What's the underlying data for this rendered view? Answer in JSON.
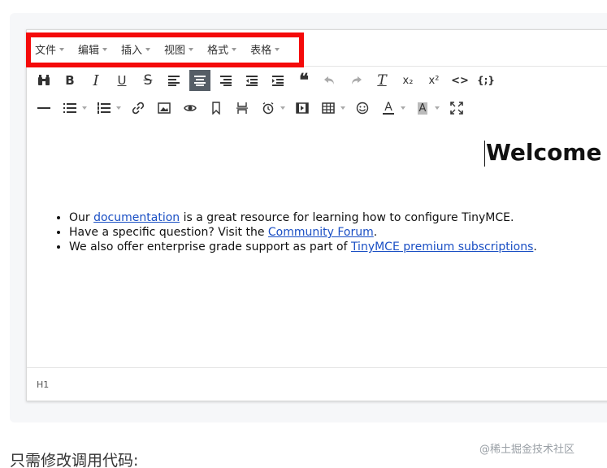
{
  "menubar": {
    "items": [
      {
        "label": "文件"
      },
      {
        "label": "编辑"
      },
      {
        "label": "插入"
      },
      {
        "label": "视图"
      },
      {
        "label": "格式"
      },
      {
        "label": "表格"
      }
    ]
  },
  "toolbar": {
    "bold": "B",
    "italic": "I",
    "underline": "U",
    "strike": "S",
    "clear_format": "T",
    "subscript": "x₂",
    "superscript": "x²",
    "code": "<>",
    "code_sample": "{;}",
    "text_color": "A",
    "bg_color": "A",
    "active_button": "align-center-button"
  },
  "content": {
    "heading": "Welcome",
    "list": [
      {
        "before": "Our ",
        "link": "documentation",
        "after": " is a great resource for learning how to configure TinyMCE."
      },
      {
        "before": "Have a specific question? Visit the ",
        "link": "Community Forum",
        "after": "."
      },
      {
        "before": "We also offer enterprise grade support as part of ",
        "link": "TinyMCE premium subscriptions",
        "after": "."
      }
    ]
  },
  "statusbar": {
    "path": "H1"
  },
  "page": {
    "caption": "只需修改调用代码:",
    "watermark": "@稀土掘金技术社区"
  },
  "colors": {
    "highlight": "#f40a0a",
    "link": "#1a4fc4",
    "active_button_bg": "#555d66"
  }
}
